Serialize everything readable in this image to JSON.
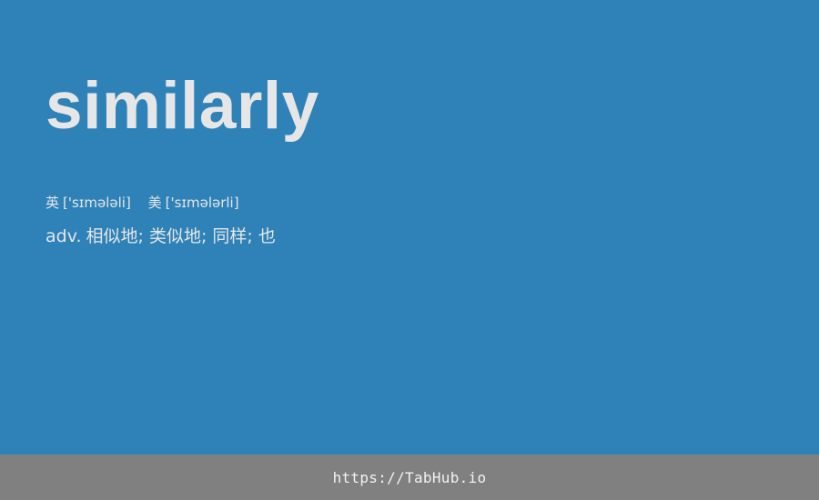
{
  "word": {
    "headword": "similarly",
    "pronunciations": [
      {
        "region": "英",
        "ipa": "['sɪmələli]"
      },
      {
        "region": "美",
        "ipa": "['sɪmələrli]"
      }
    ],
    "definition": {
      "part_of_speech": "adv.",
      "meanings": "相似地; 类似地; 同样; 也"
    }
  },
  "footer": {
    "link_text": "https://TabHub.io"
  },
  "colors": {
    "background": "#2e82b8",
    "text": "#e6e6e6",
    "footer_background": "#808080",
    "footer_text": "#f2f2f2"
  }
}
